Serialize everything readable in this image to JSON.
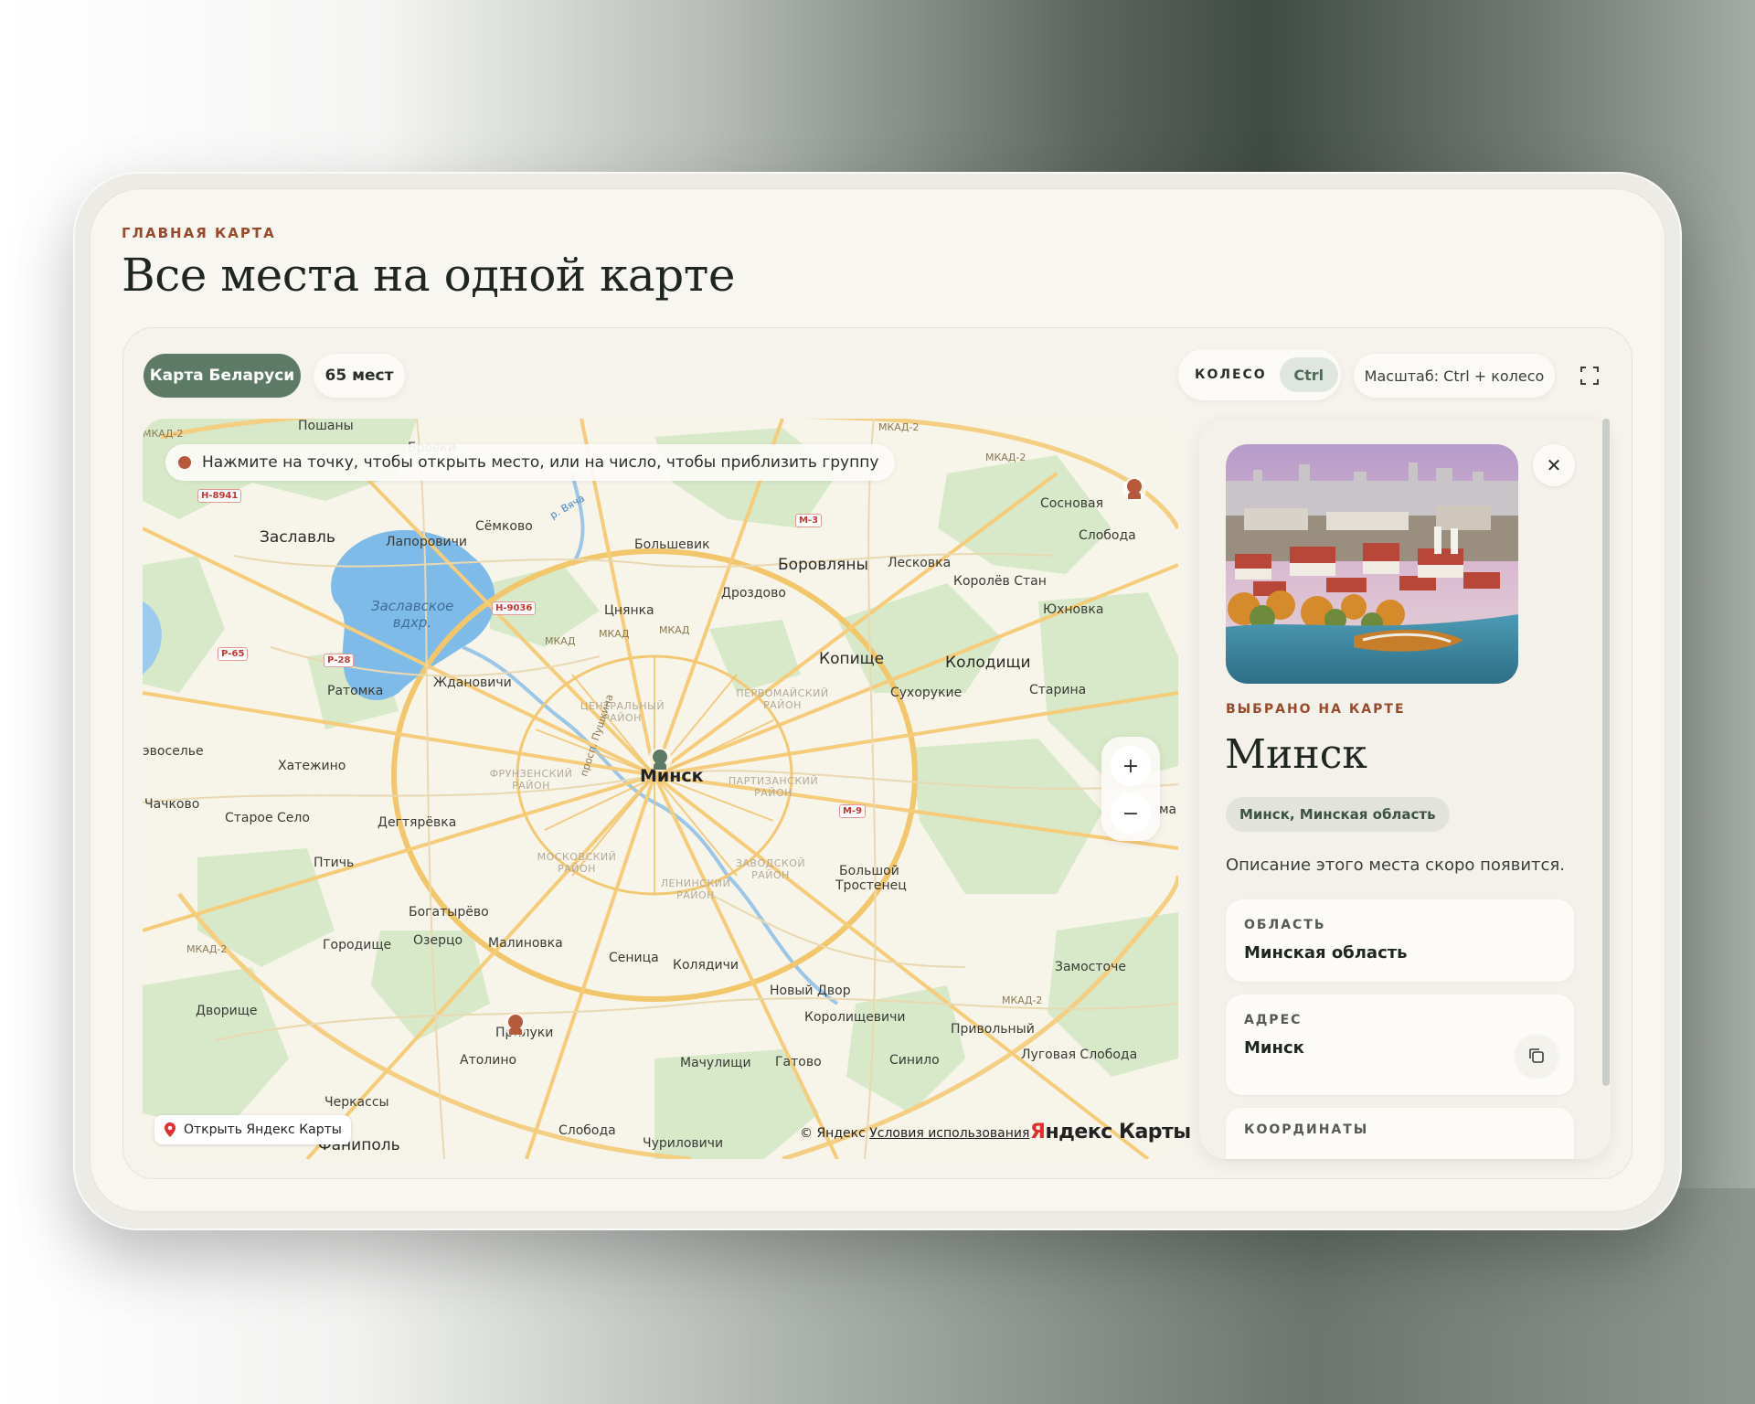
{
  "header": {
    "eyebrow": "ГЛАВНАЯ КАРТА",
    "title": "Все места на одной карте"
  },
  "toolbar": {
    "map_button": "Карта Беларуси",
    "places_count": "65 мест",
    "wheel_label": "КОЛЕСО",
    "wheel_key": "Ctrl",
    "scale_hint": "Масштаб: Ctrl + колесо",
    "fullscreen_icon": "fullscreen-icon"
  },
  "map": {
    "hint": "Нажмите на точку, чтобы открыть место, или на число, чтобы приблизить группу",
    "zoom_in": "+",
    "zoom_out": "−",
    "open_yandex": "Открыть Яндекс Карты",
    "copyright": "© Яндекс",
    "terms": "Условия использования",
    "logo_first": "Я",
    "logo_rest": "ндекс Карты",
    "labels": {
      "minsk": "Минск",
      "zaslavl": "Заславль",
      "borovlyany": "Боровляны",
      "kopische": "Копище",
      "kolodischi": "Колодищи",
      "semkovo": "Сёмково",
      "lapo": "Лапоровичи",
      "bolshevik": "Большевик",
      "leskovka": "Лесковка",
      "sosnovaya": "Сосновая",
      "sloboda": "Слобода",
      "korolev": "Королёв Стан",
      "yuhnovka": "Юхновка",
      "drozdovo": "Дроздово",
      "tsnyanka": "Цнянка",
      "zhdanovichi": "Ждановичи",
      "ratomka": "Ратомка",
      "suhorukie": "Сухорукие",
      "starina": "Старина",
      "hatezhino": "Хатежино",
      "chachkovo": "Чачково",
      "staroe": "Старое Село",
      "degtyarevka": "Дегтярёвка",
      "ptich": "Птичь",
      "bogatyrevo": "Богатырёво",
      "gorodische": "Городище",
      "ozertso": "Озерцо",
      "malinovka": "Малиновка",
      "senitsa": "Сеница",
      "kolyadichi": "Колядичи",
      "novy_dvor": "Новый Двор",
      "korol": "Королищевичи",
      "privolny": "Привольный",
      "lugovaya": "Луговая Слобода",
      "bolshoi": "Большой",
      "trostenets": "Тростенец",
      "zamostochye": "Замосточе",
      "dvorische": "Дворище",
      "priluki": "Прилуки",
      "atolino": "Атолино",
      "machulischi": "Мачулищи",
      "gatovo": "Гатово",
      "sinilo": "Синило",
      "cherkassy": "Черкассы",
      "fanipol": "Фаниполь",
      "sloboda2": "Слобода",
      "churilovichi": "Чуриловичи",
      "poshany": "Пошаны",
      "brovki": "Бровки",
      "vosele": "эвоселье",
      "lake": "Заславское вдхр.",
      "central": "ЦЕНТРАЛЬНЫЙ РАЙОН",
      "pervomay": "ПЕРВОМАЙСКИЙ РАЙОН",
      "frunzensky": "ФРУНЗЕНСКИЙ РАЙОН",
      "partizansky": "ПАРТИЗАНСКИЙ РАЙОН",
      "moskovsky": "МОСКОВСКИЙ РАЙОН",
      "zavodskoy": "ЗАВОДСКОЙ РАЙОН",
      "leninsky": "ЛЕНИНСКИЙ РАЙОН",
      "mkad": "МКАД",
      "mkad2": "МКАД-2",
      "pushkina": "просп. Пушкина",
      "vyacha": "р. Вяча",
      "ma": "ма",
      "road_h8941": "Н-8941",
      "road_m3": "М-3",
      "road_h9036": "Н-9036",
      "road_p65": "Р-65",
      "road_p28": "Р-28",
      "road_m9": "М-9"
    }
  },
  "card": {
    "selected_label": "ВЫБРАНО НА КАРТЕ",
    "name": "Минск",
    "tag": "Минск, Минская область",
    "description": "Описание этого места скоро появится.",
    "region_label": "ОБЛАСТЬ",
    "region_value": "Минская область",
    "address_label": "АДРЕС",
    "address_value": "Минск",
    "coords_label": "КООРДИНАТЫ",
    "close": "✕"
  },
  "colors": {
    "accent_green": "#5d7a66",
    "accent_rust": "#9a4a2c",
    "marker_rust": "#b75a3c",
    "marker_green": "#5d7a66"
  }
}
